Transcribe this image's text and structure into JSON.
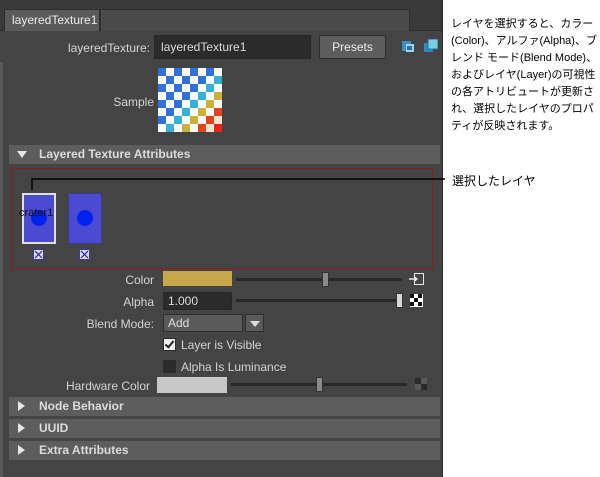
{
  "tab": {
    "label": "layeredTexture1"
  },
  "node": {
    "label": "layeredTexture:",
    "value": "layeredTexture1",
    "presets_label": "Presets"
  },
  "sample": {
    "label": "Sample"
  },
  "sections": {
    "layered": "Layered Texture Attributes",
    "node_behavior": "Node Behavior",
    "uuid": "UUID",
    "extra": "Extra Attributes"
  },
  "layers": {
    "selected_name": "crater1",
    "count": 2
  },
  "attrs": {
    "color_label": "Color",
    "color_value": "#c7a74a",
    "alpha_label": "Alpha",
    "alpha_value": "1.000",
    "blend_label": "Blend Mode:",
    "blend_value": "Add",
    "layer_visible_label": "Layer is Visible",
    "layer_visible_checked": true,
    "alpha_luminance_label": "Alpha Is Luminance",
    "alpha_luminance_checked": false,
    "hardware_color_label": "Hardware Color",
    "hardware_color_value": "#c8c8c8"
  },
  "annotation": {
    "description": "レイヤを選択すると、カラー(Color)、アルファ(Alpha)、ブレンド モード(Blend Mode)、およびレイヤ(Layer)の可視性の各アトリビュートが更新され、選択したレイヤのプロパティが反映されます。",
    "callout": "選択したレイヤ"
  },
  "icons": [
    "toolbar-icon-1",
    "toolbar-icon-2",
    "map-button-icon",
    "checker-icon",
    "layer-visibility-icon",
    "triangle-down-icon",
    "triangle-right-icon"
  ]
}
